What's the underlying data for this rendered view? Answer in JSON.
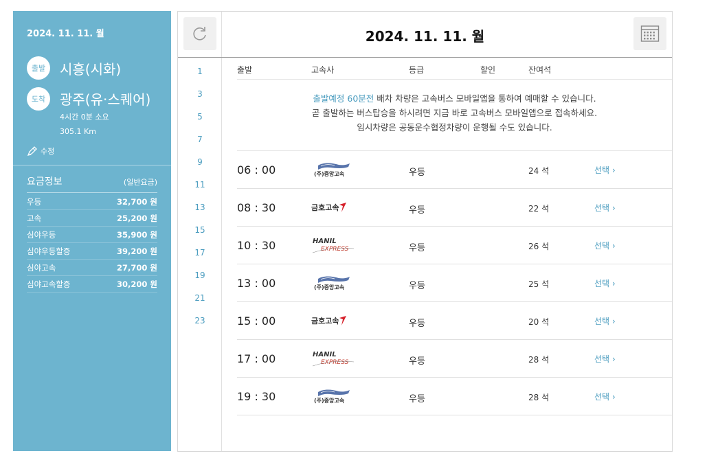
{
  "sidebar": {
    "date": "2024. 11. 11. 월",
    "departure_badge": "출발",
    "departure_city": "시흥(시화)",
    "arrival_badge": "도착",
    "arrival_city": "광주(유·스퀘어)",
    "duration": "4시간 0분 소요",
    "distance": "305.1 Km",
    "edit_label": "수정",
    "fare_title": "요금정보",
    "fare_subtitle": "(일반요금)",
    "fares": [
      {
        "name": "우등",
        "price": "32,700 원"
      },
      {
        "name": "고속",
        "price": "25,200 원"
      },
      {
        "name": "심야우등",
        "price": "35,900 원"
      },
      {
        "name": "심야우등할증",
        "price": "39,200 원"
      },
      {
        "name": "심야고속",
        "price": "27,700 원"
      },
      {
        "name": "심야고속할증",
        "price": "30,200 원"
      }
    ]
  },
  "main": {
    "title": "2024. 11. 11. 월",
    "hours": [
      "1",
      "3",
      "5",
      "7",
      "9",
      "11",
      "13",
      "15",
      "17",
      "19",
      "21",
      "23"
    ],
    "columns": {
      "departure": "출발",
      "company": "고속사",
      "grade": "등급",
      "discount": "할인",
      "seats": "잔여석"
    },
    "notice": {
      "line1_highlight": "출발예정 60분전",
      "line1_rest": " 배차 차량은 고속버스 모바일앱을 통하여 예매할 수 있습니다.",
      "line2": "곧 출발하는 버스탑승을 하시려면 지금 바로 고속버스 모바일앱으로 접속하세요.",
      "line3": "임시차량은 공동운수협정차량이 운행될 수도 있습니다."
    },
    "schedules": [
      {
        "time": "06 : 00",
        "company": "(주)중앙고속",
        "logo": "joongang",
        "grade": "우등",
        "seats": "24 석",
        "action": "선택"
      },
      {
        "time": "08 : 30",
        "company": "금호고속",
        "logo": "kumho",
        "grade": "우등",
        "seats": "22 석",
        "action": "선택"
      },
      {
        "time": "10 : 30",
        "company": "HANIL EXPRESS",
        "logo": "hanil",
        "grade": "우등",
        "seats": "26 석",
        "action": "선택"
      },
      {
        "time": "13 : 00",
        "company": "(주)중앙고속",
        "logo": "joongang",
        "grade": "우등",
        "seats": "25 석",
        "action": "선택"
      },
      {
        "time": "15 : 00",
        "company": "금호고속",
        "logo": "kumho",
        "grade": "우등",
        "seats": "20 석",
        "action": "선택"
      },
      {
        "time": "17 : 00",
        "company": "HANIL EXPRESS",
        "logo": "hanil",
        "grade": "우등",
        "seats": "28 석",
        "action": "선택"
      },
      {
        "time": "19 : 30",
        "company": "(주)중앙고속",
        "logo": "joongang",
        "grade": "우등",
        "seats": "28 석",
        "action": "선택"
      }
    ]
  },
  "colors": {
    "sidebar_bg": "#6db4cf",
    "accent": "#4a9cbf",
    "kumho_red": "#d6202a"
  },
  "icons": {
    "refresh": "refresh-icon",
    "calendar": "calendar-icon",
    "edit": "pencil-icon"
  }
}
